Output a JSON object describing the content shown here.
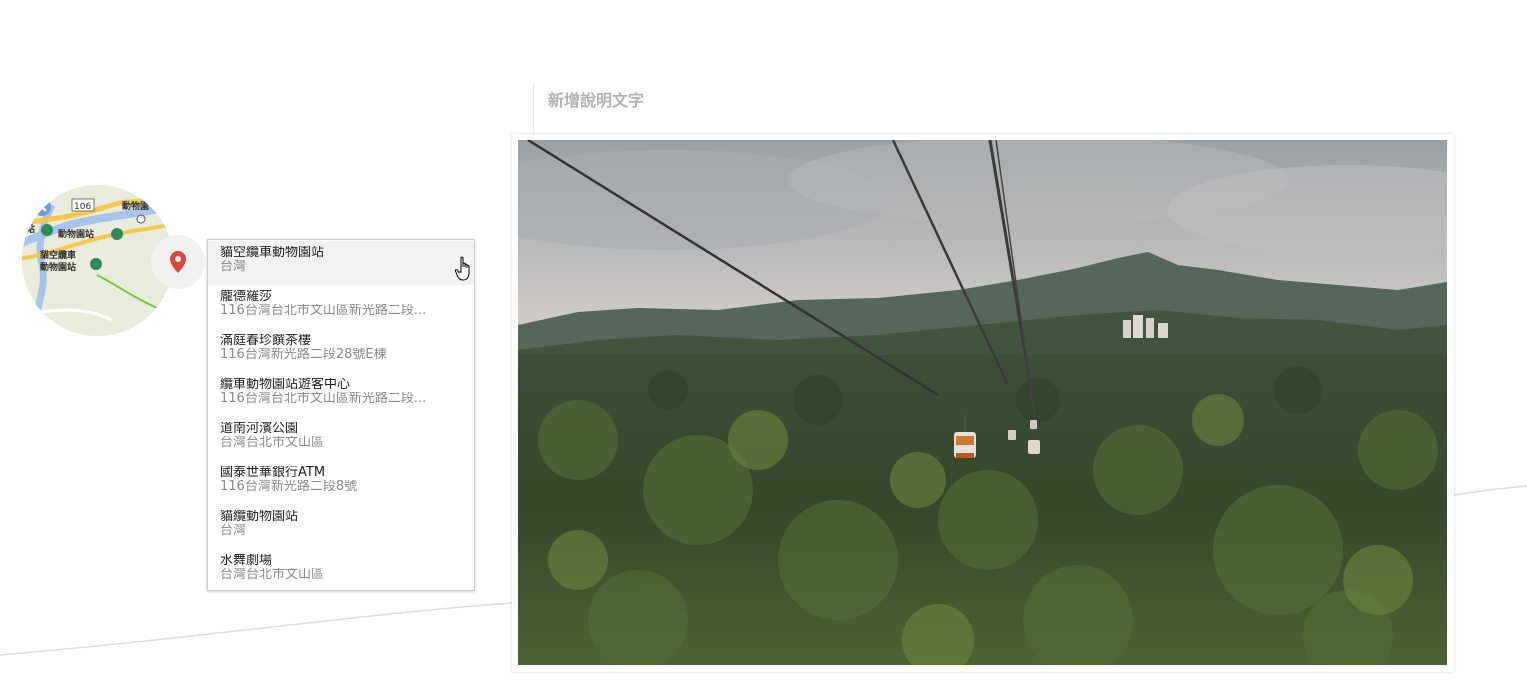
{
  "caption": {
    "placeholder": "新增說明文字"
  },
  "map_thumbnail": {
    "labels": [
      "106",
      "動物園",
      "站",
      "動物園站",
      "貓空纜車",
      "動物園站"
    ]
  },
  "location_pin": {
    "icon": "map-pin-icon",
    "color": "#e0463a"
  },
  "location_suggestions": [
    {
      "name": "貓空纜車動物園站",
      "address": "台灣"
    },
    {
      "name": "龐德羅莎",
      "address": "116台灣台北市文山區新光路二段..."
    },
    {
      "name": "滿庭春珍饌茶樓",
      "address": "116台灣新光路二段28號E棟"
    },
    {
      "name": "纜車動物園站遊客中心",
      "address": "116台灣台北市文山區新光路二段..."
    },
    {
      "name": "道南河濱公園",
      "address": "台灣台北市文山區"
    },
    {
      "name": "國泰世華銀行ATM",
      "address": "116台灣新光路二段8號"
    },
    {
      "name": "貓纜動物園站",
      "address": "台灣"
    },
    {
      "name": "水舞劇場",
      "address": "台灣台北市文山區"
    }
  ],
  "photo": {
    "subject": "gondola-cable-car-over-forest"
  }
}
